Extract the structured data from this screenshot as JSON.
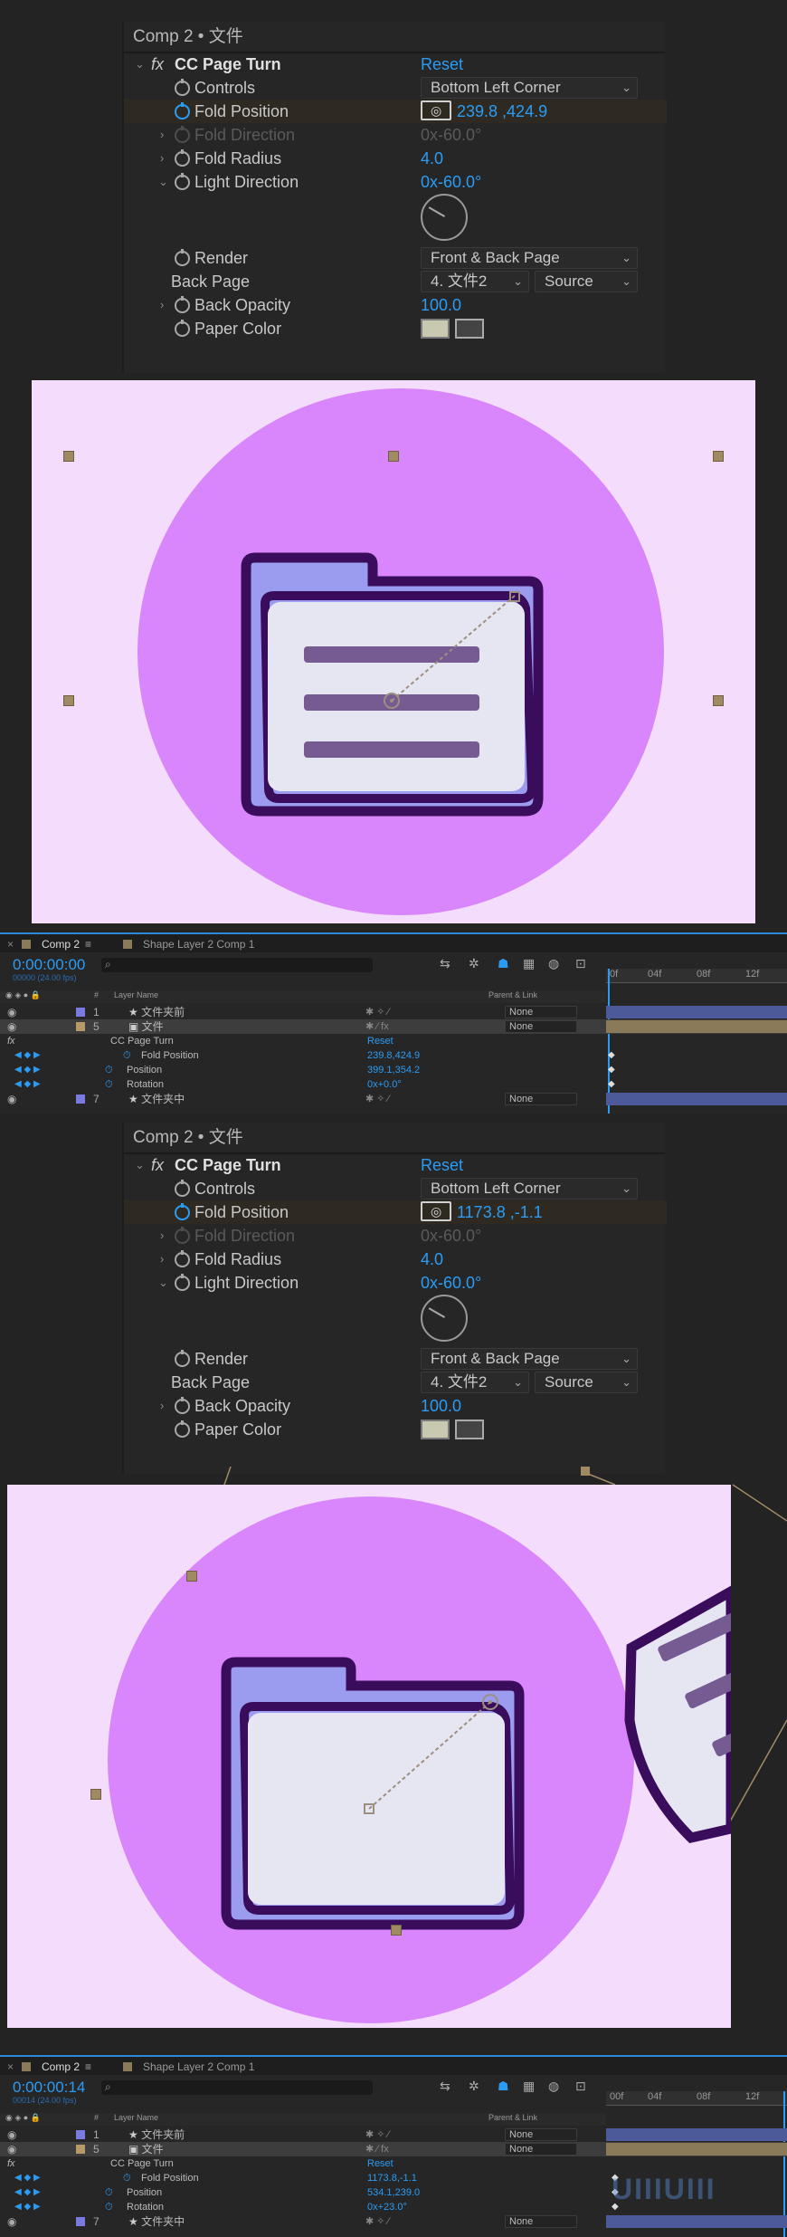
{
  "panels": [
    {
      "effect_controls": {
        "header": "Comp 2 • 文件",
        "effect_name": "CC Page Turn",
        "reset_label": "Reset",
        "fx_label": "fx",
        "props": {
          "controls": {
            "label": "Controls",
            "value": "Bottom Left Corner"
          },
          "fold_position": {
            "label": "Fold Position",
            "value": "239.8 ,424.9"
          },
          "fold_direction": {
            "label": "Fold Direction",
            "value": "0x-60.0°"
          },
          "fold_radius": {
            "label": "Fold Radius",
            "value": "4.0"
          },
          "light_direction": {
            "label": "Light Direction",
            "value": "0x-60.0°"
          },
          "render": {
            "label": "Render",
            "value": "Front & Back Page"
          },
          "back_page": {
            "label": "Back Page",
            "value": "4. 文件2",
            "value2": "Source"
          },
          "back_opacity": {
            "label": "Back Opacity",
            "value": "100.0"
          },
          "paper_color": {
            "label": "Paper Color"
          }
        }
      },
      "timeline": {
        "tab_comp": "Comp 2",
        "tab_shape": "Shape Layer 2 Comp 1",
        "timecode": "0:00:00:00",
        "frames": "00000 (24.00 fps)",
        "ruler": [
          "0f",
          "04f",
          "08f",
          "12f"
        ],
        "col_hash": "#",
        "col_layer": "Layer Name",
        "col_parent": "Parent & Link",
        "layers": [
          {
            "num": "1",
            "name": "文件夹前",
            "parent": "None"
          },
          {
            "num": "5",
            "name": "文件",
            "parent": "None"
          },
          {
            "num": "7",
            "name": "文件夹中",
            "parent": "None"
          }
        ],
        "effect_row": "CC Page Turn",
        "effect_reset": "Reset",
        "props": [
          {
            "name": "Fold Position",
            "value": "239.8,424.9"
          },
          {
            "name": "Position",
            "value": "399.1,354.2"
          },
          {
            "name": "Rotation",
            "value": "0x+0.0°"
          }
        ]
      }
    },
    {
      "effect_controls": {
        "header": "Comp 2 • 文件",
        "effect_name": "CC Page Turn",
        "reset_label": "Reset",
        "fx_label": "fx",
        "props": {
          "controls": {
            "label": "Controls",
            "value": "Bottom Left Corner"
          },
          "fold_position": {
            "label": "Fold Position",
            "value": "1173.8 ,-1.1"
          },
          "fold_direction": {
            "label": "Fold Direction",
            "value": "0x-60.0°"
          },
          "fold_radius": {
            "label": "Fold Radius",
            "value": "4.0"
          },
          "light_direction": {
            "label": "Light Direction",
            "value": "0x-60.0°"
          },
          "render": {
            "label": "Render",
            "value": "Front & Back Page"
          },
          "back_page": {
            "label": "Back Page",
            "value": "4. 文件2",
            "value2": "Source"
          },
          "back_opacity": {
            "label": "Back Opacity",
            "value": "100.0"
          },
          "paper_color": {
            "label": "Paper Color"
          }
        }
      },
      "timeline": {
        "tab_comp": "Comp 2",
        "tab_shape": "Shape Layer 2 Comp 1",
        "timecode": "0:00:00:14",
        "frames": "00014 (24.00 fps)",
        "ruler": [
          "00f",
          "04f",
          "08f",
          "12f"
        ],
        "col_hash": "#",
        "col_layer": "Layer Name",
        "col_parent": "Parent & Link",
        "layers": [
          {
            "num": "1",
            "name": "文件夹前",
            "parent": "None"
          },
          {
            "num": "5",
            "name": "文件",
            "parent": "None"
          },
          {
            "num": "7",
            "name": "文件夹中",
            "parent": "None"
          }
        ],
        "effect_row": "CC Page Turn",
        "effect_reset": "Reset",
        "props": [
          {
            "name": "Fold Position",
            "value": "1173.8,-1.1"
          },
          {
            "name": "Position",
            "value": "534.1,239.0"
          },
          {
            "name": "Rotation",
            "value": "0x+23.0°"
          }
        ]
      }
    }
  ],
  "colors": {
    "accent": "#2b9cf5",
    "comp_bg": "#f4dcfd",
    "circle": "#d985fb",
    "folder_back": "#9b9bf0",
    "folder_outline": "#3a0c5c",
    "paper": "#e6e6f2",
    "line": "#765a92"
  },
  "watermark": "UIIIUIII"
}
